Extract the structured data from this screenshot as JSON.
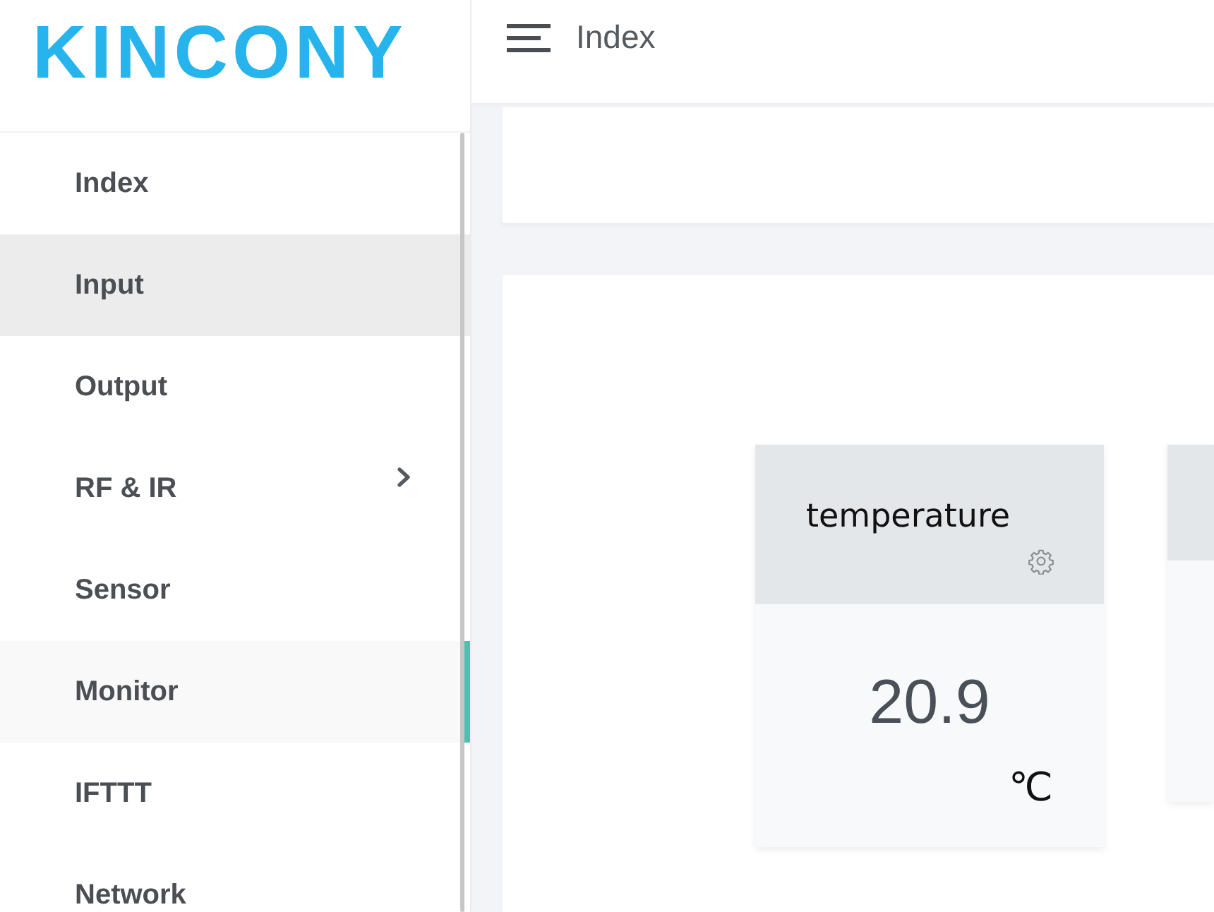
{
  "logo": {
    "text": "KINCONY"
  },
  "header": {
    "title": "Index"
  },
  "sidebar": {
    "items": [
      {
        "label": "Index",
        "selected": false,
        "hovered": false,
        "has_submenu": false
      },
      {
        "label": "Input",
        "selected": false,
        "hovered": true,
        "has_submenu": false
      },
      {
        "label": "Output",
        "selected": false,
        "hovered": false,
        "has_submenu": false
      },
      {
        "label": "RF & IR",
        "selected": false,
        "hovered": false,
        "has_submenu": true
      },
      {
        "label": "Sensor",
        "selected": false,
        "hovered": false,
        "has_submenu": false
      },
      {
        "label": "Monitor",
        "selected": true,
        "hovered": false,
        "has_submenu": false
      },
      {
        "label": "IFTTT",
        "selected": false,
        "hovered": false,
        "has_submenu": false
      },
      {
        "label": "Network",
        "selected": false,
        "hovered": false,
        "has_submenu": false
      }
    ]
  },
  "sensor_cards": [
    {
      "kind": "sensor",
      "title": "temperature",
      "value": "20.9",
      "unit": "℃"
    },
    {
      "kind": "clipped"
    }
  ]
}
